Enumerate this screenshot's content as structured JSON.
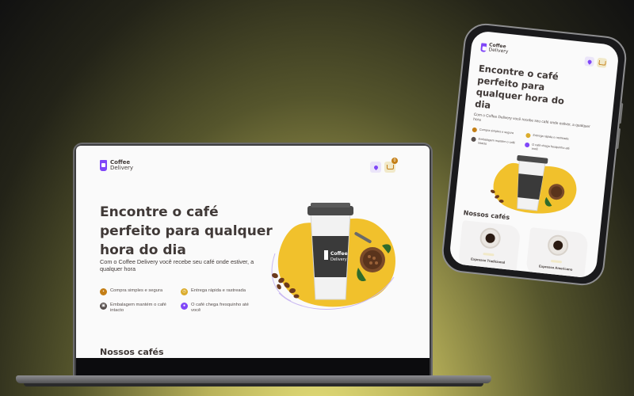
{
  "site": {
    "logo": {
      "line1": "Coffee",
      "line2": "Delivery"
    },
    "cart_count": "0",
    "hero": {
      "title": "Encontre o café perfeito para qualquer hora do dia",
      "subtitle": "Com o Coffee Delivery você recebe seu café onde estiver, a qualquer hora"
    },
    "features": [
      {
        "label": "Compra simples e segura",
        "icon": "cart-icon",
        "color": "#C47F17"
      },
      {
        "label": "Entrega rápida e rastreada",
        "icon": "timer-icon",
        "color": "#DBAC2C"
      },
      {
        "label": "Embalagem mantém o café intacto",
        "icon": "package-icon",
        "color": "#574F4D"
      },
      {
        "label": "O café chega fresquinho até você",
        "icon": "coffee-icon",
        "color": "#8047F8"
      }
    ],
    "section_title": "Nossos cafés",
    "coffees": [
      {
        "name": "Expresso Tradicional"
      },
      {
        "name": "Expresso Americano"
      }
    ]
  },
  "colors": {
    "purple": "#8047F8",
    "yellow": "#DBAC2C",
    "yellow_dark": "#C47F17",
    "text": "#403937"
  }
}
